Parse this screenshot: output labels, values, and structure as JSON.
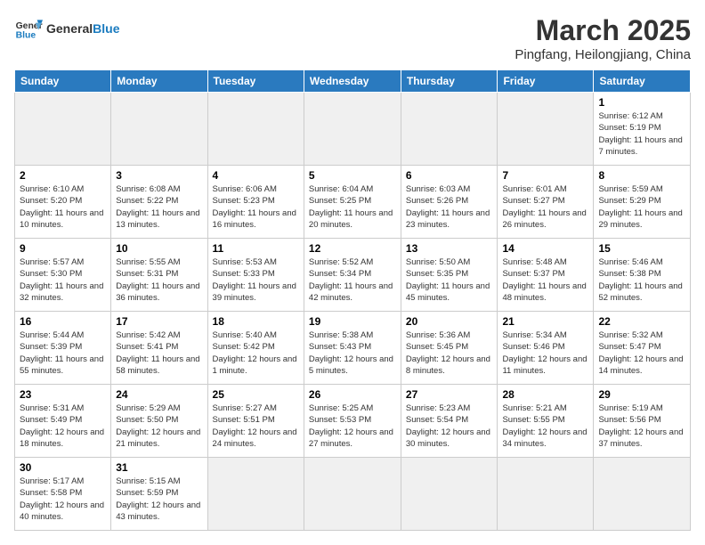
{
  "header": {
    "logo_general": "General",
    "logo_blue": "Blue",
    "month_title": "March 2025",
    "subtitle": "Pingfang, Heilongjiang, China"
  },
  "weekdays": [
    "Sunday",
    "Monday",
    "Tuesday",
    "Wednesday",
    "Thursday",
    "Friday",
    "Saturday"
  ],
  "weeks": [
    [
      {
        "day": "",
        "info": "",
        "empty": true
      },
      {
        "day": "",
        "info": "",
        "empty": true
      },
      {
        "day": "",
        "info": "",
        "empty": true
      },
      {
        "day": "",
        "info": "",
        "empty": true
      },
      {
        "day": "",
        "info": "",
        "empty": true
      },
      {
        "day": "",
        "info": "",
        "empty": true
      },
      {
        "day": "1",
        "info": "Sunrise: 6:12 AM\nSunset: 5:19 PM\nDaylight: 11 hours and 7 minutes."
      }
    ],
    [
      {
        "day": "2",
        "info": "Sunrise: 6:10 AM\nSunset: 5:20 PM\nDaylight: 11 hours and 10 minutes."
      },
      {
        "day": "3",
        "info": "Sunrise: 6:08 AM\nSunset: 5:22 PM\nDaylight: 11 hours and 13 minutes."
      },
      {
        "day": "4",
        "info": "Sunrise: 6:06 AM\nSunset: 5:23 PM\nDaylight: 11 hours and 16 minutes."
      },
      {
        "day": "5",
        "info": "Sunrise: 6:04 AM\nSunset: 5:25 PM\nDaylight: 11 hours and 20 minutes."
      },
      {
        "day": "6",
        "info": "Sunrise: 6:03 AM\nSunset: 5:26 PM\nDaylight: 11 hours and 23 minutes."
      },
      {
        "day": "7",
        "info": "Sunrise: 6:01 AM\nSunset: 5:27 PM\nDaylight: 11 hours and 26 minutes."
      },
      {
        "day": "8",
        "info": "Sunrise: 5:59 AM\nSunset: 5:29 PM\nDaylight: 11 hours and 29 minutes."
      }
    ],
    [
      {
        "day": "9",
        "info": "Sunrise: 5:57 AM\nSunset: 5:30 PM\nDaylight: 11 hours and 32 minutes."
      },
      {
        "day": "10",
        "info": "Sunrise: 5:55 AM\nSunset: 5:31 PM\nDaylight: 11 hours and 36 minutes."
      },
      {
        "day": "11",
        "info": "Sunrise: 5:53 AM\nSunset: 5:33 PM\nDaylight: 11 hours and 39 minutes."
      },
      {
        "day": "12",
        "info": "Sunrise: 5:52 AM\nSunset: 5:34 PM\nDaylight: 11 hours and 42 minutes."
      },
      {
        "day": "13",
        "info": "Sunrise: 5:50 AM\nSunset: 5:35 PM\nDaylight: 11 hours and 45 minutes."
      },
      {
        "day": "14",
        "info": "Sunrise: 5:48 AM\nSunset: 5:37 PM\nDaylight: 11 hours and 48 minutes."
      },
      {
        "day": "15",
        "info": "Sunrise: 5:46 AM\nSunset: 5:38 PM\nDaylight: 11 hours and 52 minutes."
      }
    ],
    [
      {
        "day": "16",
        "info": "Sunrise: 5:44 AM\nSunset: 5:39 PM\nDaylight: 11 hours and 55 minutes."
      },
      {
        "day": "17",
        "info": "Sunrise: 5:42 AM\nSunset: 5:41 PM\nDaylight: 11 hours and 58 minutes."
      },
      {
        "day": "18",
        "info": "Sunrise: 5:40 AM\nSunset: 5:42 PM\nDaylight: 12 hours and 1 minute."
      },
      {
        "day": "19",
        "info": "Sunrise: 5:38 AM\nSunset: 5:43 PM\nDaylight: 12 hours and 5 minutes."
      },
      {
        "day": "20",
        "info": "Sunrise: 5:36 AM\nSunset: 5:45 PM\nDaylight: 12 hours and 8 minutes."
      },
      {
        "day": "21",
        "info": "Sunrise: 5:34 AM\nSunset: 5:46 PM\nDaylight: 12 hours and 11 minutes."
      },
      {
        "day": "22",
        "info": "Sunrise: 5:32 AM\nSunset: 5:47 PM\nDaylight: 12 hours and 14 minutes."
      }
    ],
    [
      {
        "day": "23",
        "info": "Sunrise: 5:31 AM\nSunset: 5:49 PM\nDaylight: 12 hours and 18 minutes."
      },
      {
        "day": "24",
        "info": "Sunrise: 5:29 AM\nSunset: 5:50 PM\nDaylight: 12 hours and 21 minutes."
      },
      {
        "day": "25",
        "info": "Sunrise: 5:27 AM\nSunset: 5:51 PM\nDaylight: 12 hours and 24 minutes."
      },
      {
        "day": "26",
        "info": "Sunrise: 5:25 AM\nSunset: 5:53 PM\nDaylight: 12 hours and 27 minutes."
      },
      {
        "day": "27",
        "info": "Sunrise: 5:23 AM\nSunset: 5:54 PM\nDaylight: 12 hours and 30 minutes."
      },
      {
        "day": "28",
        "info": "Sunrise: 5:21 AM\nSunset: 5:55 PM\nDaylight: 12 hours and 34 minutes."
      },
      {
        "day": "29",
        "info": "Sunrise: 5:19 AM\nSunset: 5:56 PM\nDaylight: 12 hours and 37 minutes."
      }
    ],
    [
      {
        "day": "30",
        "info": "Sunrise: 5:17 AM\nSunset: 5:58 PM\nDaylight: 12 hours and 40 minutes."
      },
      {
        "day": "31",
        "info": "Sunrise: 5:15 AM\nSunset: 5:59 PM\nDaylight: 12 hours and 43 minutes."
      },
      {
        "day": "",
        "info": "",
        "empty": true
      },
      {
        "day": "",
        "info": "",
        "empty": true
      },
      {
        "day": "",
        "info": "",
        "empty": true
      },
      {
        "day": "",
        "info": "",
        "empty": true
      },
      {
        "day": "",
        "info": "",
        "empty": true
      }
    ]
  ]
}
